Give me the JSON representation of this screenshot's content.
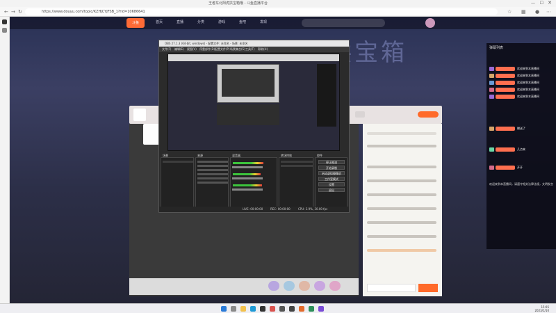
{
  "browser": {
    "tab_title": "王者东北阳虎拱宝箱哦 - 斗鱼直播平台",
    "url": "https://www.douyu.com/topic/KZHJCYJFSB_1?rid=10686641"
  },
  "site": {
    "nav": [
      "首页",
      "直播",
      "分类",
      "游戏",
      "鱼吧",
      "发现"
    ],
    "logo": "斗鱼",
    "hero_text": "王者东北阳虎拱宝箱"
  },
  "obs": {
    "title": "OBS 27.1.3 (64-bit, windows) - 配置文件: 未命名 - 场景: 未命名",
    "menu": [
      "文件(F)",
      "编辑(E)",
      "视图(V)",
      "停靠部件(D)",
      "配置文件(P)",
      "场景集合(S)",
      "工具(T)",
      "帮助(H)"
    ],
    "docks": {
      "scenes": "场景",
      "sources": "来源",
      "mixer": "混音器",
      "transitions": "转场特效",
      "controls": "控件"
    },
    "controls": [
      "停止推流",
      "开始录制",
      "启动虚拟摄像机",
      "工作室模式",
      "设置",
      "退出"
    ],
    "status": {
      "live": "LIVE: 00:00:00",
      "rec": "REC: 00:00:00",
      "cpu": "CPU: 3.9%, 30.00 fps"
    }
  },
  "danmu": {
    "header": "弹幕列表",
    "lines": [
      {
        "tx": "欢迎来到本直播间"
      },
      {
        "tx": "欢迎来到本直播间"
      },
      {
        "tx": "欢迎来到本直播间"
      },
      {
        "tx": "欢迎来到本直播间"
      },
      {
        "tx": "欢迎来到本直播间"
      },
      {
        "tx": "赠送了"
      },
      {
        "tx": "几点来"
      },
      {
        "tx": "开开"
      }
    ],
    "system": "欢迎来到本直播间，请遵守相关法律法规，文明发言"
  },
  "taskbar": {
    "time": "15:05",
    "date": "2023/1/10"
  }
}
